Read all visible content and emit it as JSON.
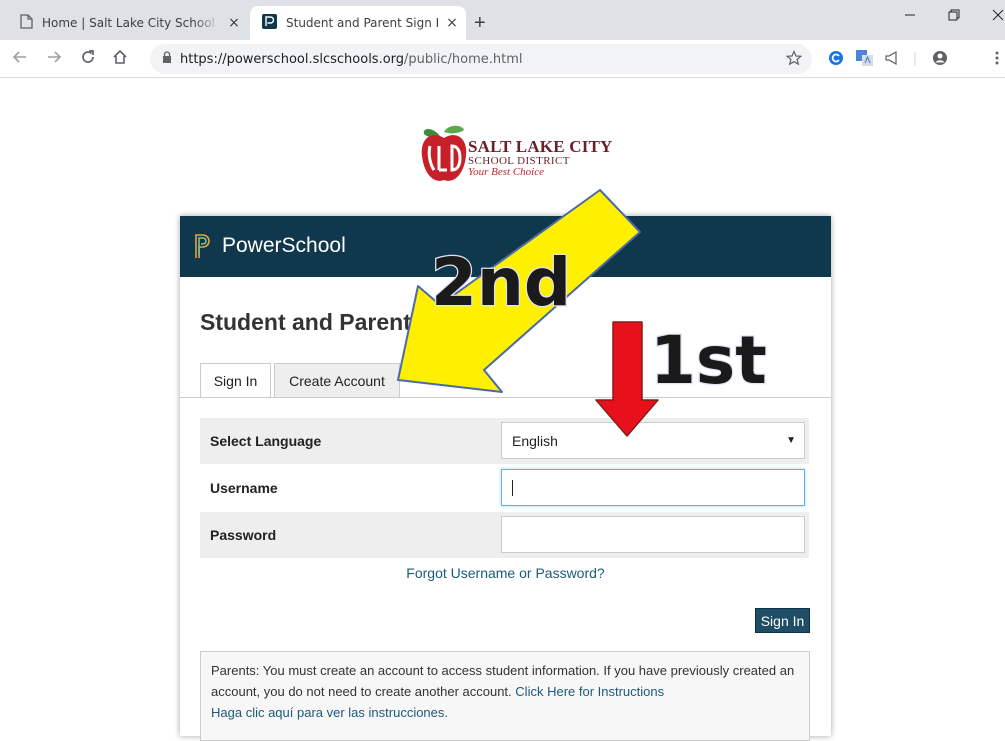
{
  "browser": {
    "tabs": [
      {
        "title": "Home | Salt Lake City School District",
        "active": false
      },
      {
        "title": "Student and Parent Sign In",
        "active": true
      }
    ],
    "close_glyph": "×",
    "new_tab_glyph": "+",
    "url_host": "https://powerschool.slcschools.org",
    "url_path": "/public/home.html"
  },
  "logo": {
    "line1": "SALT LAKE CITY",
    "line2": "SCHOOL DISTRICT",
    "line3": "Your Best Choice"
  },
  "header": {
    "product": "PowerSchool"
  },
  "page": {
    "heading": "Student and Parent Sign In"
  },
  "form_tabs": {
    "sign_in": "Sign In",
    "create_account": "Create Account"
  },
  "form": {
    "language_label": "Select Language",
    "language_value": "English",
    "username_label": "Username",
    "username_value": "",
    "password_label": "Password",
    "password_value": "",
    "forgot_link": "Forgot Username or Password?",
    "submit_label": "Sign In"
  },
  "notice": {
    "text": "Parents: You must create an account to access student information. If you have previously created an account, you do not need to create another account.",
    "link_en": "Click Here for Instructions",
    "link_es": "Haga clic aquí para ver las instrucciones."
  },
  "annotations": {
    "first_label": "1st",
    "second_label": "2nd"
  },
  "colors": {
    "header_bg": "#10384d",
    "button_bg": "#1d4e66",
    "arrow_red": "#e8111b",
    "arrow_yellow": "#fff000"
  }
}
